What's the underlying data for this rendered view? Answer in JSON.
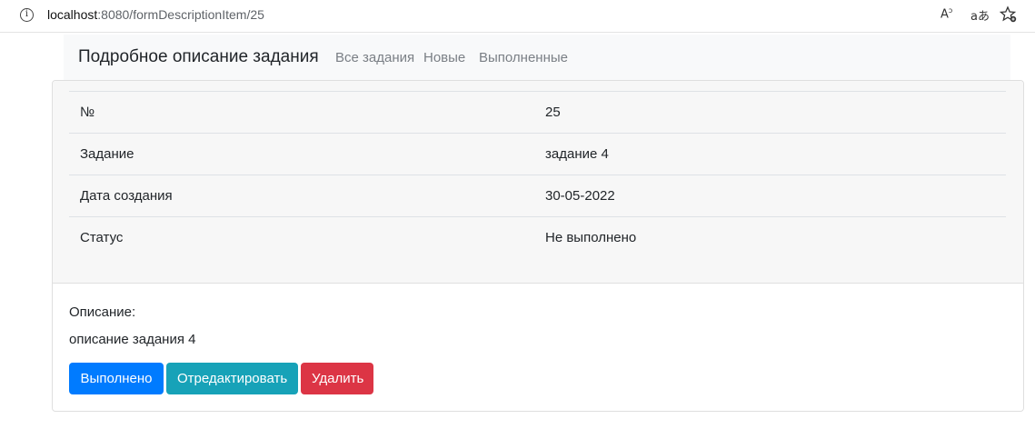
{
  "browser": {
    "url_host": "localhost",
    "url_rest": ":8080/formDescriptionItem/25",
    "icons": [
      "info-icon",
      "read-aloud-icon",
      "translate-icon",
      "favorites-icon"
    ]
  },
  "navbar": {
    "brand": "Подробное описание задания",
    "links": [
      "Все задания",
      "Новые",
      "Выполненные"
    ]
  },
  "details": {
    "rows": [
      {
        "label": "№",
        "value": "25"
      },
      {
        "label": "Задание",
        "value": "задание 4"
      },
      {
        "label": "Дата создания",
        "value": "30-05-2022"
      },
      {
        "label": "Статус",
        "value": "Не выполнено"
      }
    ]
  },
  "description": {
    "label": "Описание:",
    "text": "описание задания 4"
  },
  "buttons": {
    "done": "Выполнено",
    "edit": "Отредактировать",
    "delete": "Удалить"
  },
  "colors": {
    "primary": "#007bff",
    "info": "#17a2b8",
    "danger": "#dc3545",
    "navbar_bg": "#f8f9fa"
  }
}
